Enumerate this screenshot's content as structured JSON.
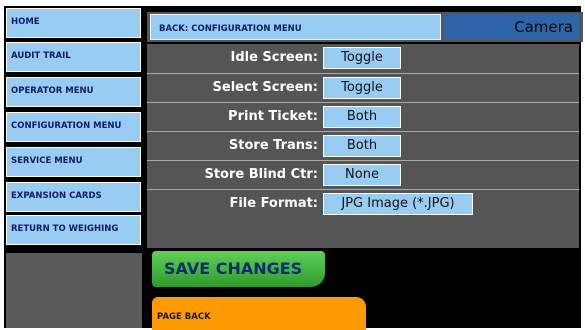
{
  "sidebar": {
    "items": [
      {
        "label": "HOME"
      },
      {
        "label": "AUDIT TRAIL"
      },
      {
        "label": "OPERATOR MENU"
      },
      {
        "label": "CONFIGURATION MENU"
      },
      {
        "label": "SERVICE MENU"
      },
      {
        "label": "EXPANSION CARDS"
      },
      {
        "label": "RETURN TO WEIGHING"
      }
    ]
  },
  "header": {
    "back_label": "BACK: CONFIGURATION MENU",
    "title": "Camera"
  },
  "settings": [
    {
      "label": "Idle Screen:",
      "value": "Toggle"
    },
    {
      "label": "Select Screen:",
      "value": "Toggle"
    },
    {
      "label": "Print Ticket:",
      "value": "Both"
    },
    {
      "label": "Store Trans:",
      "value": "Both"
    },
    {
      "label": "Store Blind Ctr:",
      "value": "None"
    },
    {
      "label": "File Format:",
      "value": "JPG Image (*.JPG)"
    }
  ],
  "actions": {
    "save_label": "SAVE CHANGES",
    "page_back_label": "PAGE BACK"
  },
  "colors": {
    "nav_button": "#99ccf2",
    "panel": "#555555",
    "title_box": "#2f65a6",
    "save": "#3fb53b",
    "page_back": "#ff9a00"
  }
}
